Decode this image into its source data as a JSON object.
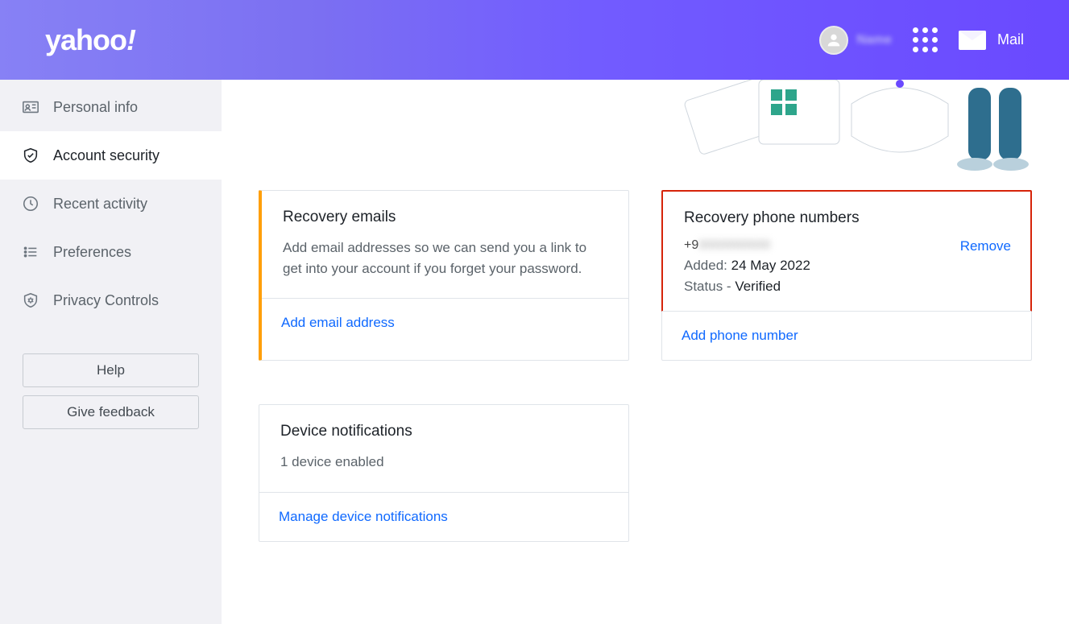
{
  "header": {
    "logo_text": "yahoo",
    "logo_bang": "!",
    "user_name": "Name",
    "mail_label": "Mail"
  },
  "sidebar": {
    "items": [
      {
        "label": "Personal info",
        "name": "sidebar-item-personal-info"
      },
      {
        "label": "Account security",
        "name": "sidebar-item-account-security"
      },
      {
        "label": "Recent activity",
        "name": "sidebar-item-recent-activity"
      },
      {
        "label": "Preferences",
        "name": "sidebar-item-preferences"
      },
      {
        "label": "Privacy Controls",
        "name": "sidebar-item-privacy-controls"
      }
    ],
    "help_label": "Help",
    "feedback_label": "Give feedback"
  },
  "cards": {
    "recovery_emails": {
      "title": "Recovery emails",
      "desc": "Add email addresses so we can send you a link to get into your account if you forget your password.",
      "action": "Add email address"
    },
    "recovery_phones": {
      "title": "Recovery phone numbers",
      "phone_prefix": "+9",
      "phone_hidden": "0000000000",
      "remove_label": "Remove",
      "added_label": "Added:",
      "added_value": "24 May 2022",
      "status_label": "Status -",
      "status_value": "Verified",
      "action": "Add phone number"
    },
    "device_notifications": {
      "title": "Device notifications",
      "desc": "1 device enabled",
      "action": "Manage device notifications"
    }
  }
}
